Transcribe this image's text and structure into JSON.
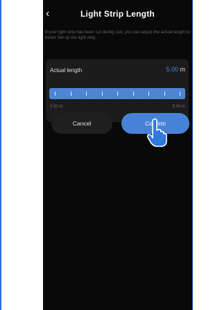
{
  "header": {
    "back_icon": "chevron-left-icon",
    "back_glyph": "‹",
    "title": "Light Strip Length"
  },
  "info_text": "If your light strip has been cut during use, you can adjust the actual length to better Set up the light strip.",
  "length_card": {
    "label": "Actual length",
    "value": "5.00",
    "unit": "m",
    "slider": {
      "min_label": "0.50 m",
      "max_label": "5.00 m",
      "min": 0.5,
      "max": 5.0,
      "value": 5.0,
      "tick_count": 9
    }
  },
  "buttons": {
    "cancel_label": "Cancel",
    "confirm_label": "Confirm"
  },
  "overlay": {
    "cursor_icon": "hand-pointer-icon"
  },
  "colors": {
    "accent": "#4683d6",
    "value_blue": "#3c8ae6",
    "background": "#090909",
    "card": "#1c1c1c",
    "frame": "#1d6fd6"
  }
}
